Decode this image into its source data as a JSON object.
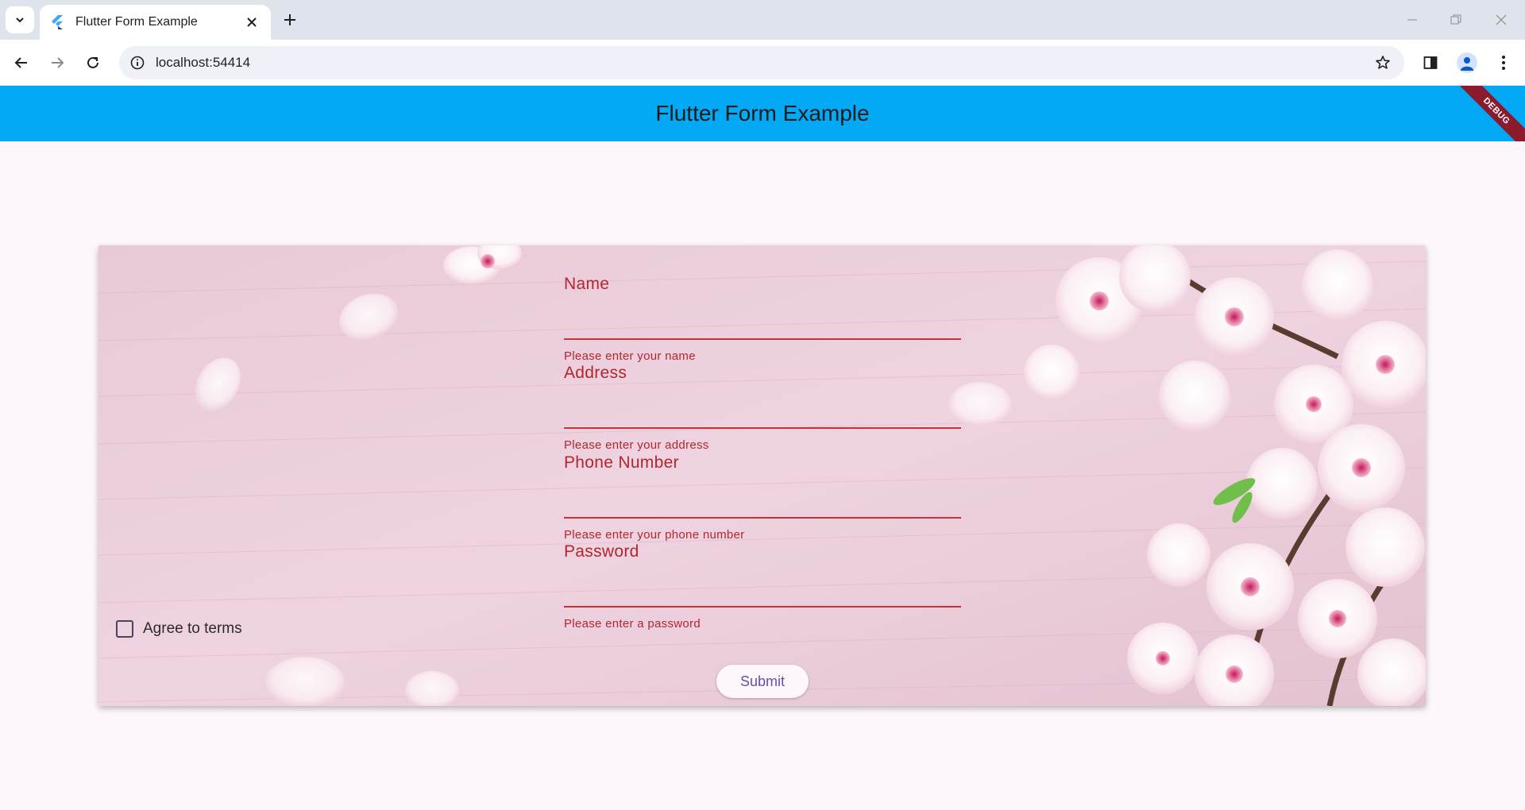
{
  "browser": {
    "tab_title": "Flutter Form Example",
    "url": "localhost:54414",
    "favicon": "flutter-icon"
  },
  "app": {
    "title": "Flutter Form Example",
    "debug_label": "DEBUG",
    "colors": {
      "appbar": "#03a9f4",
      "error": "#b3262e",
      "button_text": "#6750a4",
      "page_bg": "#fdf7fc"
    }
  },
  "form": {
    "fields": [
      {
        "label": "Name",
        "error": "Please enter your name",
        "value": ""
      },
      {
        "label": "Address",
        "error": "Please enter your address",
        "value": ""
      },
      {
        "label": "Phone Number",
        "error": "Please enter your phone number",
        "value": ""
      },
      {
        "label": "Password",
        "error": "Please enter a password",
        "value": ""
      }
    ],
    "agree_label": "Agree to terms",
    "agree_checked": false,
    "submit_label": "Submit",
    "background": "pink cherry blossom wood photo"
  }
}
